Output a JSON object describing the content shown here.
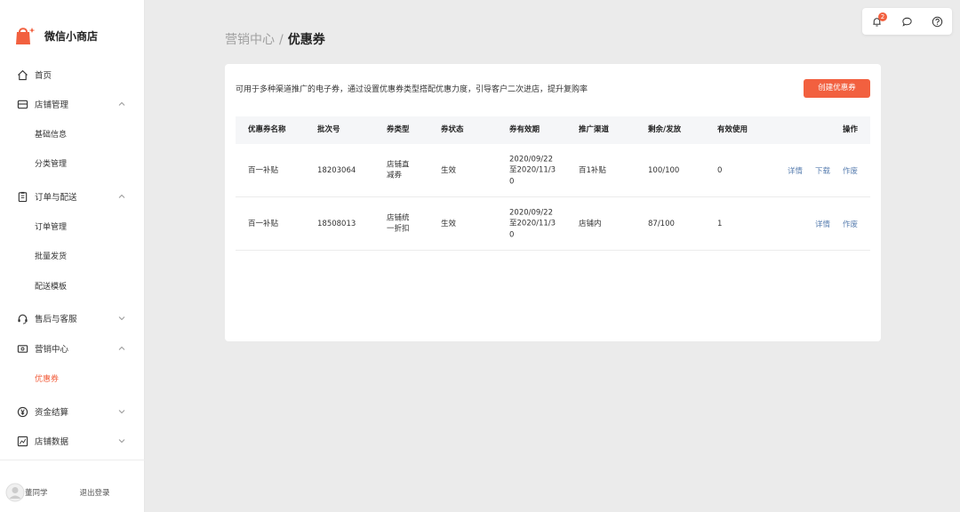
{
  "app": {
    "name": "微信小商店",
    "brand_color": "#f2603f"
  },
  "sidebar": {
    "items": [
      {
        "label": "首页",
        "icon": "home-icon"
      },
      {
        "label": "店铺管理",
        "icon": "store-icon",
        "expanded": true,
        "children": [
          {
            "label": "基础信息"
          },
          {
            "label": "分类管理"
          }
        ]
      },
      {
        "label": "订单与配送",
        "icon": "clipboard-icon",
        "expanded": true,
        "children": [
          {
            "label": "订单管理"
          },
          {
            "label": "批量发货"
          },
          {
            "label": "配送模板"
          }
        ]
      },
      {
        "label": "售后与客服",
        "icon": "headset-icon",
        "expanded": false
      },
      {
        "label": "营销中心",
        "icon": "ticket-icon",
        "expanded": true,
        "children": [
          {
            "label": "优惠券",
            "active": true
          }
        ]
      },
      {
        "label": "资金结算",
        "icon": "yen-icon",
        "expanded": false
      },
      {
        "label": "店铺数据",
        "icon": "chart-icon",
        "expanded": false
      }
    ],
    "user_name": "董同学",
    "logout_label": "退出登录"
  },
  "header": {
    "breadcrumb_parent": "营销中心",
    "breadcrumb_sep": "/",
    "breadcrumb_current": "优惠券",
    "notification_count": "2"
  },
  "coupon": {
    "description": "可用于多种渠道推广的电子券，通过设置优惠券类型搭配优惠力度，引导客户二次进店，提升复购率",
    "create_label": "创建优惠券",
    "columns": [
      "优惠券名称",
      "批次号",
      "券类型",
      "券状态",
      "券有效期",
      "推广渠道",
      "剩余/发放",
      "有效使用",
      "操作"
    ],
    "rows": [
      {
        "name": "百一补贴",
        "batch": "18203064",
        "type_l1": "店铺直",
        "type_l2": "减券",
        "status": "生效",
        "valid_l1": "2020/09/22",
        "valid_l2": "至2020/11/3",
        "valid_l3": "0",
        "channel": "百1补贴",
        "remaining": "100/100",
        "used": "0",
        "actions": [
          "详情",
          "下载",
          "作废"
        ]
      },
      {
        "name": "百一补贴",
        "batch": "18508013",
        "type_l1": "店铺统",
        "type_l2": "一折扣",
        "status": "生效",
        "valid_l1": "2020/09/22",
        "valid_l2": "至2020/11/3",
        "valid_l3": "0",
        "channel": "店铺内",
        "remaining": "87/100",
        "used": "1",
        "actions": [
          "详情",
          "作废"
        ]
      }
    ]
  }
}
